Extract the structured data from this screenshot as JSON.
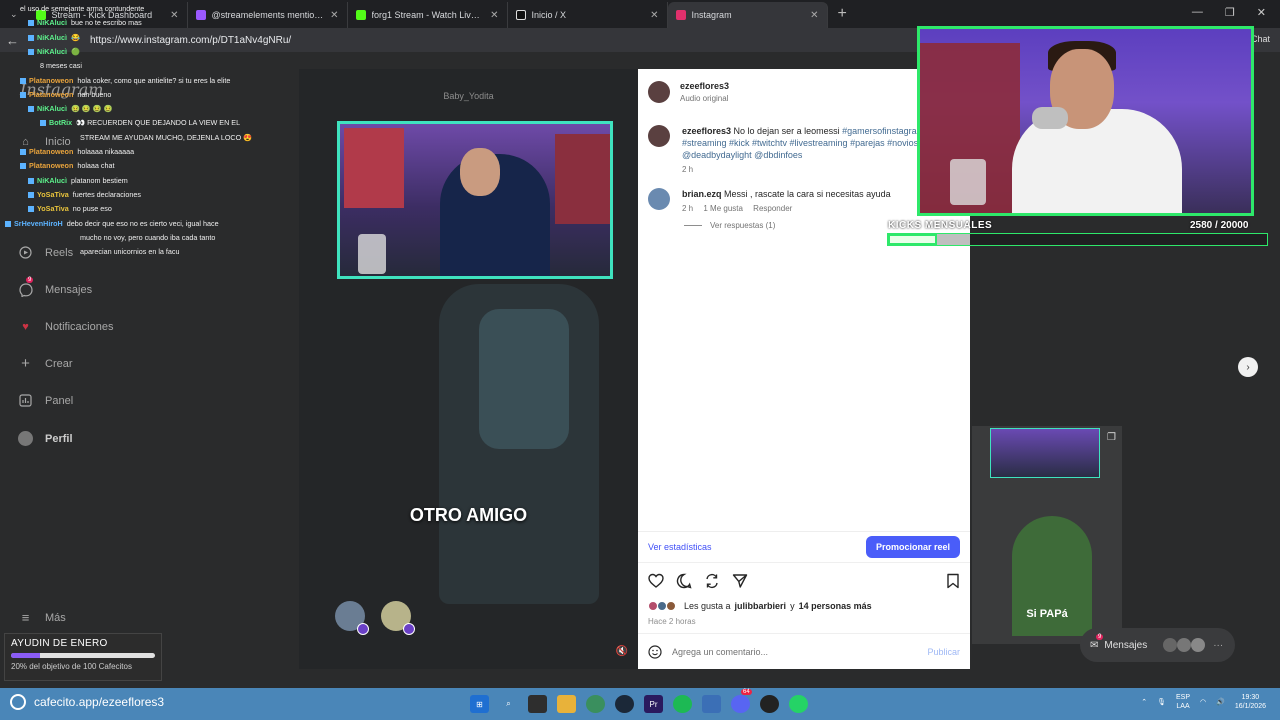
{
  "browser": {
    "tabs": [
      {
        "label": "Stream - Kick Dashboard",
        "color": "#53fc18"
      },
      {
        "label": "@streamelements mentioned",
        "color": "#9b59ff"
      },
      {
        "label": "forg1 Stream - Watch Live on Kick",
        "color": "#53fc18"
      },
      {
        "label": "Inicio / X",
        "color": "#dddddd"
      },
      {
        "label": "Instagram",
        "color": "#e1306c"
      }
    ],
    "url": "https://www.instagram.com/p/DT1aNv4gNRu/",
    "chat_label": "Chat"
  },
  "instagram": {
    "logo": "Instagram",
    "nav": [
      {
        "label": "Inicio"
      },
      {
        "label": "Reels"
      },
      {
        "label": "Mensajes",
        "badge": "9"
      },
      {
        "label": "Notificaciones"
      },
      {
        "label": "Crear"
      },
      {
        "label": "Panel"
      },
      {
        "label": "Perfil"
      },
      {
        "label": "Más"
      }
    ],
    "video": {
      "username": "Baby_Yodita",
      "caption": "OTRO AMIGO"
    },
    "post": {
      "author": "ezeeflores3",
      "audio": "Audio original",
      "caption_user": "ezeeflores3",
      "caption_text": "No lo dejan ser a leomessi",
      "caption_tags": "#gamersofinstagram #streaming #kick #twitchtv #livestreaming #parejas #novios @deadbydaylight @dbdinfoes",
      "caption_time": "2 h",
      "comment_user": "brian.ezq",
      "comment_text": "Messi , rascate la cara si necesitas ayuda",
      "comment_time": "2 h",
      "comment_likes": "1 Me gusta",
      "reply_label": "Responder",
      "view_replies": "Ver respuestas (1)",
      "stats_link": "Ver estadísticas",
      "promote_button": "Promocionar reel",
      "likes_prefix": "Les gusta a",
      "likes_user": "julibbarbieri",
      "likes_join": "y",
      "likes_others": "14 personas más",
      "time_ago": "Hace 2 horas",
      "comment_placeholder": "Agrega un comentario...",
      "publish_label": "Publicar"
    },
    "right_thumb_caption": "Si PAPá",
    "messages_button": "Mensajes",
    "messages_badge": "9"
  },
  "stream_overlay": {
    "chat": [
      {
        "user": "",
        "msg": "el uso de semejante arma contundente",
        "color": "#ffffff"
      },
      {
        "user": "NiKAlucì",
        "msg": "bue no te escribo mas",
        "color": "#5cf08b"
      },
      {
        "user": "NiKAlucì",
        "msg": "😂",
        "color": "#5cf08b"
      },
      {
        "user": "NiKAlucì",
        "msg": "🟢",
        "color": "#5cf08b"
      },
      {
        "user": "",
        "msg": "8 meses casi",
        "color": "#ffffff"
      },
      {
        "user": "Platanoweon",
        "msg": "hola coker, como que antielite? si tu eres la elite",
        "color": "#e8a33c"
      },
      {
        "user": "Platanoweon",
        "msg": "nah bueno",
        "color": "#e8a33c"
      },
      {
        "user": "NiKAlucì",
        "msg": "🤢 🤢 🤢 🤢",
        "color": "#5cf08b"
      },
      {
        "user": "BotRix",
        "msg": "👀 RECUERDEN QUE DEJANDO LA VIEW EN EL",
        "color": "#5cf08b"
      },
      {
        "user": "",
        "msg": "STREAM ME AYUDAN MUCHO, DEJENLA LOCO 😍",
        "color": "#ffffff"
      },
      {
        "user": "Platanoweon",
        "msg": "holaaaa nikaaaaa",
        "color": "#e8a33c"
      },
      {
        "user": "Platanoweon",
        "msg": "holaaa chat",
        "color": "#e8a33c"
      },
      {
        "user": "NiKAlucì",
        "msg": "platanom bestiem",
        "color": "#5cf08b"
      },
      {
        "user": "YoSaTiva",
        "msg": "fuertes declaraciones",
        "color": "#e8c33c"
      },
      {
        "user": "YoSaTiva",
        "msg": "no puse eso",
        "color": "#e8c33c"
      },
      {
        "user": "SrHevenHiroH",
        "msg": "debo decir que eso no es cierto veci, igual hace",
        "color": "#5cb3ff"
      },
      {
        "user": "",
        "msg": "mucho no voy, pero cuando iba cada tanto",
        "color": "#ffffff"
      },
      {
        "user": "",
        "msg": "aparecian unicornios en la facu",
        "color": "#ffffff"
      }
    ],
    "kicks_label": "KICKS MENSUALES",
    "kicks_count": "2580  / 20000",
    "kicks_progress": 0.129,
    "goal_title": "AYUDIN DE ENERO",
    "goal_text": "20% del objetivo de 100 Cafecitos",
    "goal_progress": 0.2
  },
  "taskbar": {
    "cafecito": "cafecito.app/ezeeflores3",
    "lang_top": "ESP",
    "lang_bottom": "LAA",
    "time": "19:30",
    "date": "16/1/2026",
    "notif_badge": "64"
  },
  "colors": {
    "ig_blue": "#4a5df9",
    "stream_green": "#2ee86a",
    "cam_teal": "#3fe3bf",
    "taskbar": "#4a86b8"
  }
}
